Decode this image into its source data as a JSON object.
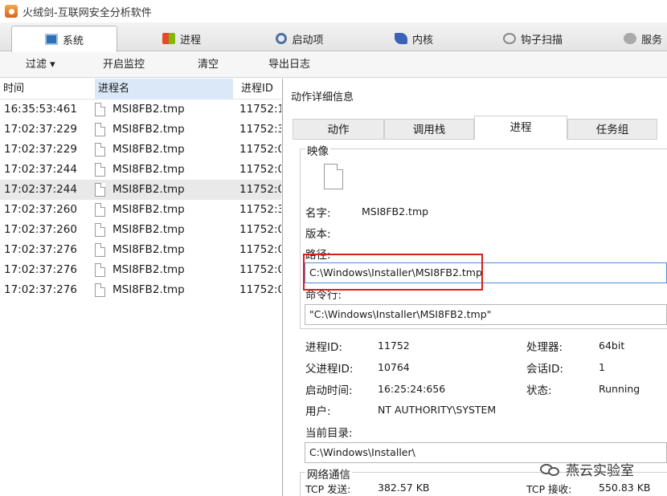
{
  "window": {
    "title": "火绒剑-互联网安全分析软件"
  },
  "main_tabs": [
    {
      "label": "系统",
      "icon": "system-icon",
      "active": true
    },
    {
      "label": "进程",
      "icon": "process-icon",
      "active": false
    },
    {
      "label": "启动项",
      "icon": "startup-icon",
      "active": false
    },
    {
      "label": "内核",
      "icon": "kernel-icon",
      "active": false
    },
    {
      "label": "钩子扫描",
      "icon": "hook-scan-icon",
      "active": false
    },
    {
      "label": "服务",
      "icon": "service-icon",
      "active": false
    }
  ],
  "toolbar": {
    "filter": "过滤 ▾",
    "start_monitor": "开启监控",
    "clear": "清空",
    "export_log": "导出日志"
  },
  "list": {
    "columns": [
      "时间",
      "进程名",
      "进程ID"
    ],
    "rows": [
      {
        "time": "16:35:53:461",
        "name": "MSI8FB2.tmp",
        "pid": "11752:1",
        "selected": false
      },
      {
        "time": "17:02:37:229",
        "name": "MSI8FB2.tmp",
        "pid": "11752:3",
        "selected": false
      },
      {
        "time": "17:02:37:229",
        "name": "MSI8FB2.tmp",
        "pid": "11752:0",
        "selected": false
      },
      {
        "time": "17:02:37:244",
        "name": "MSI8FB2.tmp",
        "pid": "11752:0",
        "selected": false
      },
      {
        "time": "17:02:37:244",
        "name": "MSI8FB2.tmp",
        "pid": "11752:0",
        "selected": true
      },
      {
        "time": "17:02:37:260",
        "name": "MSI8FB2.tmp",
        "pid": "11752:3",
        "selected": false
      },
      {
        "time": "17:02:37:260",
        "name": "MSI8FB2.tmp",
        "pid": "11752:0",
        "selected": false
      },
      {
        "time": "17:02:37:276",
        "name": "MSI8FB2.tmp",
        "pid": "11752:0",
        "selected": false
      },
      {
        "time": "17:02:37:276",
        "name": "MSI8FB2.tmp",
        "pid": "11752:0",
        "selected": false
      },
      {
        "time": "17:02:37:276",
        "name": "MSI8FB2.tmp",
        "pid": "11752:0",
        "selected": false
      }
    ]
  },
  "detail": {
    "title": "动作详细信息",
    "tabs": [
      "动作",
      "调用栈",
      "进程",
      "任务组"
    ],
    "active_tab": 2,
    "image_group": "映像",
    "name_label": "名字:",
    "name_value": "MSI8FB2.tmp",
    "version_label": "版本:",
    "path_label": "路径:",
    "path_value": "C:\\Windows\\Installer\\MSI8FB2.tmp",
    "cmdline_label": "命令行:",
    "cmdline_value": "\"C:\\Windows\\Installer\\MSI8FB2.tmp\"",
    "pid_label": "进程ID:",
    "pid_value": "11752",
    "cpu_label": "处理器:",
    "cpu_value": "64bit",
    "ppid_label": "父进程ID:",
    "ppid_value": "10764",
    "session_label": "会话ID:",
    "session_value": "1",
    "start_label": "启动时间:",
    "start_value": "16:25:24:656",
    "status_label": "状态:",
    "status_value": "Running",
    "user_label": "用户:",
    "user_value": "NT AUTHORITY\\SYSTEM",
    "cwd_label": "当前目录:",
    "cwd_value": "C:\\Windows\\Installer\\",
    "net_group": "网络通信",
    "tcp_send_label": "TCP 发送:",
    "tcp_send_value": "382.57 KB",
    "tcp_recv_label": "TCP 接收:",
    "tcp_recv_value": "550.83 KB"
  },
  "watermark": {
    "text": "燕云实验室"
  },
  "colors": {
    "highlight_box": "#e01b1b",
    "sorted_header": "#dbe8f7",
    "selected_row": "#e9e9e9"
  }
}
